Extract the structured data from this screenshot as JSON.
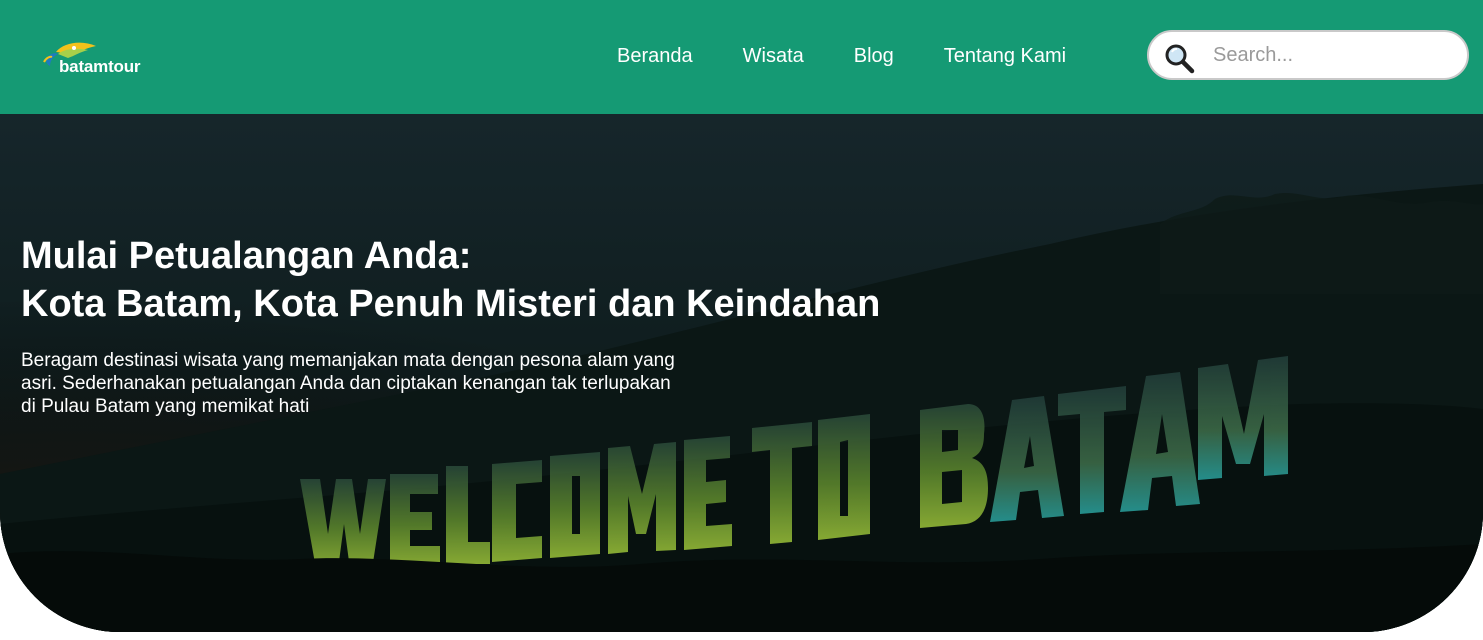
{
  "header": {
    "logo_text": "batamtour",
    "nav": [
      {
        "label": "Beranda"
      },
      {
        "label": "Wisata"
      },
      {
        "label": "Blog"
      },
      {
        "label": "Tentang Kami"
      }
    ],
    "search": {
      "placeholder": "Search...",
      "value": "",
      "icon": "search-icon"
    }
  },
  "hero": {
    "title_line1": "Mulai Petualangan Anda:",
    "title_line2": "Kota Batam, Kota Penuh Misteri dan Keindahan",
    "description": "Beragam destinasi wisata yang memanjakan mata dengan pesona alam yang asri. Sederhanakan petualangan Anda dan ciptakan kenangan tak terlupakan di Pulau Batam yang memikat hati",
    "sign_text": "WELCOME TO BATAM"
  },
  "colors": {
    "header_bg": "#159a74",
    "hero_bg": "#0d1a1a",
    "sign_green": "#8fb83a"
  }
}
